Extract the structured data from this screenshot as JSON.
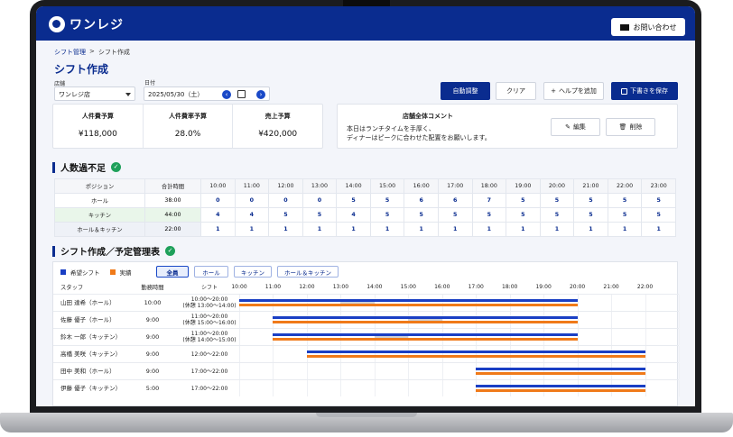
{
  "header": {
    "logo_text": "ワンレジ",
    "contact_label": "お問い合わせ"
  },
  "breadcrumb": {
    "root": "シフト管理",
    "separator": ">",
    "current": "シフト作成"
  },
  "page_title": "シフト作成",
  "store": {
    "label": "店舗",
    "value": "ワンレジ店"
  },
  "date": {
    "label": "日付",
    "value": "2025/05/30（土）"
  },
  "actions": {
    "auto_adjust": "自動調整",
    "clear": "クリア",
    "add_help": "ヘルプを追加",
    "save_draft": "下書きを保存"
  },
  "budget": [
    {
      "label": "人件費予算",
      "value": "¥118,000"
    },
    {
      "label": "人件費率予算",
      "value": "28.0%"
    },
    {
      "label": "売上予算",
      "value": "¥420,000"
    }
  ],
  "comment": {
    "title": "店舗全体コメント",
    "line1": "本日はランチタイムを手厚く、",
    "line2": "ディナーはピークに合わせた配置をお願いします。",
    "edit": "編集",
    "delete": "削除"
  },
  "staffing": {
    "title": "人数過不足",
    "headers": {
      "position": "ポジション",
      "total": "合計時間"
    },
    "hours": [
      "10:00",
      "11:00",
      "12:00",
      "13:00",
      "14:00",
      "15:00",
      "16:00",
      "17:00",
      "18:00",
      "19:00",
      "20:00",
      "21:00",
      "22:00",
      "23:00"
    ],
    "rows": [
      {
        "position": "ホール",
        "total": "38:00",
        "counts": [
          "0",
          "0",
          "0",
          "0",
          "5",
          "5",
          "6",
          "6",
          "7",
          "5",
          "5",
          "5",
          "5",
          "5"
        ]
      },
      {
        "position": "キッチン",
        "total": "44:00",
        "counts": [
          "4",
          "4",
          "5",
          "5",
          "4",
          "5",
          "5",
          "5",
          "5",
          "5",
          "5",
          "5",
          "5",
          "5"
        ]
      },
      {
        "position": "ホール＆キッチン",
        "total": "22:00",
        "counts": [
          "1",
          "1",
          "1",
          "1",
          "1",
          "1",
          "1",
          "1",
          "1",
          "1",
          "1",
          "1",
          "1",
          "1"
        ]
      }
    ]
  },
  "shift": {
    "title": "シフト作成／予定管理表",
    "legend": {
      "plan": "希望シフト",
      "actual": "実績"
    },
    "colors": {
      "plan": "#1a3fc4",
      "actual": "#f07a19"
    },
    "filters": [
      "全員",
      "ホール",
      "キッチン",
      "ホール＆キッチン"
    ],
    "headers": {
      "staff": "スタッフ",
      "hours": "勤務時間",
      "shift": "シフト"
    },
    "ticks": [
      "10:00",
      "11:00",
      "12:00",
      "13:00",
      "14:00",
      "15:00",
      "16:00",
      "17:00",
      "18:00",
      "19:00",
      "20:00",
      "21:00",
      "22:00"
    ],
    "rows": [
      {
        "name": "山田 達希（ホール）",
        "hours": "10:00",
        "shift": "10:00〜20:00",
        "break": "(休憩 13:00〜14:00)",
        "start": 10,
        "end": 20,
        "break_start": 13,
        "break_end": 14
      },
      {
        "name": "佐藤 優子（ホール）",
        "hours": "9:00",
        "shift": "11:00〜20:00",
        "break": "(休憩 15:00〜16:00)",
        "start": 11,
        "end": 20,
        "break_start": 15,
        "break_end": 16
      },
      {
        "name": "鈴木 一郎（キッチン）",
        "hours": "9:00",
        "shift": "11:00〜20:00",
        "break": "(休憩 14:00〜15:00)",
        "start": 11,
        "end": 20,
        "break_start": 14,
        "break_end": 15
      },
      {
        "name": "高橋 美咲（キッチン）",
        "hours": "9:00",
        "shift": "12:00〜22:00",
        "break": "",
        "start": 12,
        "end": 22,
        "break_start": null,
        "break_end": null
      },
      {
        "name": "田中 美和（ホール）",
        "hours": "9:00",
        "shift": "17:00〜22:00",
        "break": "",
        "start": 17,
        "end": 22,
        "break_start": null,
        "break_end": null
      },
      {
        "name": "伊藤 優子（キッチン）",
        "hours": "5:00",
        "shift": "17:00〜22:00",
        "break": "",
        "start": 17,
        "end": 22,
        "break_start": null,
        "break_end": null
      }
    ]
  }
}
